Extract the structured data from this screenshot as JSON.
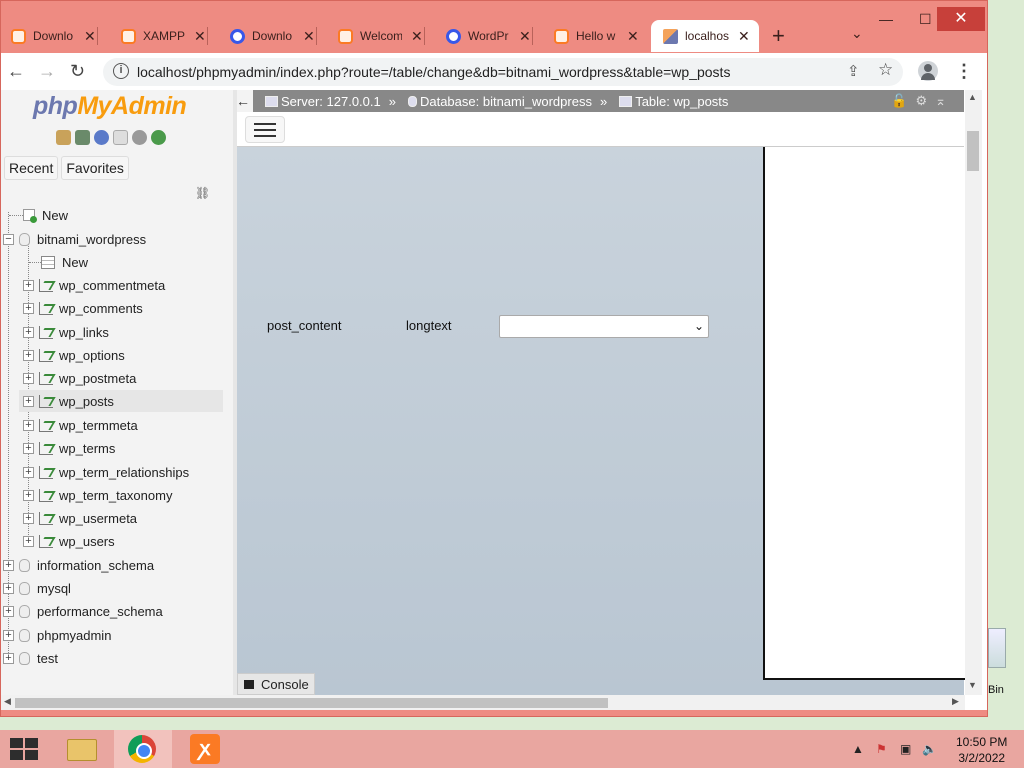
{
  "browser": {
    "tabs": [
      {
        "label": "Downlo",
        "icon": "xampp-icon"
      },
      {
        "label": "XAMPP",
        "icon": "xampp-icon"
      },
      {
        "label": "Downlo",
        "icon": "wordpress-icon"
      },
      {
        "label": "Welcom",
        "icon": "xampp-icon"
      },
      {
        "label": "WordPr",
        "icon": "wordpress-icon"
      },
      {
        "label": "Hello w",
        "icon": "xampp-icon"
      },
      {
        "label": "localhos",
        "icon": "phpmyadmin-icon",
        "active": true
      }
    ],
    "new_tab": "+",
    "url": "localhost/phpmyadmin/index.php?route=/table/change&db=bitnami_wordpress&table=wp_posts"
  },
  "navigation": {
    "logo_php": "php",
    "logo_myadmin": "MyAdmin",
    "tabs": [
      "Recent",
      "Favorites"
    ],
    "tree": {
      "new_root": "New",
      "db_open": "bitnami_wordpress",
      "db_new": "New",
      "tables": [
        "wp_commentmeta",
        "wp_comments",
        "wp_links",
        "wp_options",
        "wp_postmeta",
        "wp_posts",
        "wp_termmeta",
        "wp_terms",
        "wp_term_relationships",
        "wp_term_taxonomy",
        "wp_usermeta",
        "wp_users"
      ],
      "selected_table": "wp_posts",
      "databases": [
        "information_schema",
        "mysql",
        "performance_schema",
        "phpmyadmin",
        "test"
      ]
    }
  },
  "breadcrumb": {
    "server": "Server: 127.0.0.1",
    "database": "Database: bitnami_wordpress",
    "table": "Table: wp_posts",
    "separator": "»"
  },
  "form": {
    "field_name": "post_content",
    "field_type": "longtext",
    "function_value": ""
  },
  "console": {
    "label": "Console"
  },
  "desktop": {
    "recycle_bin_label": "Bin"
  },
  "taskbar": {
    "time": "10:50 PM",
    "date": "3/2/2022"
  },
  "colors": {
    "window_frame": "#ee8b82",
    "taskbar": "#e9a6a0",
    "breadcrumb_bg": "#888888",
    "content_bg": "#c4cfd9",
    "pma_blue": "#6c78af",
    "pma_orange": "#f89c0e"
  }
}
